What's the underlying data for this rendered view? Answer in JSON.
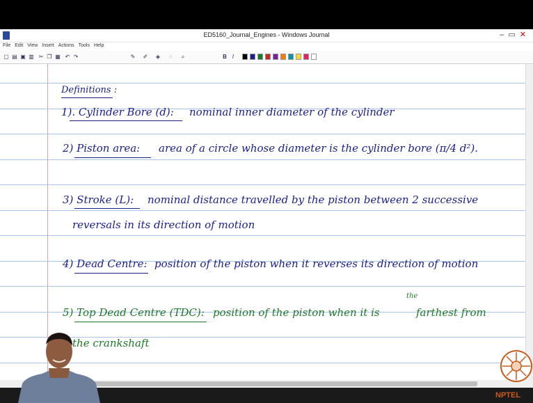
{
  "window": {
    "title": "ED5160_Journal_Engines - Windows Journal",
    "controls": [
      "–",
      "▭",
      "✕"
    ]
  },
  "menu": [
    "File",
    "Edit",
    "View",
    "Insert",
    "Actions",
    "Tools",
    "Help"
  ],
  "toolbar": {
    "icons": [
      "new-icon",
      "open-icon",
      "save-icon",
      "print-icon",
      "cut-icon",
      "copy-icon",
      "paste-icon",
      "undo-icon",
      "redo-icon",
      "pen-icon",
      "highlighter-icon",
      "eraser-icon",
      "lasso-icon",
      "zoom-icon"
    ],
    "format": [
      "B",
      "I"
    ],
    "colors": [
      "#000000",
      "#1b1f8a",
      "#1d7a28",
      "#c62828",
      "#7b1fa2",
      "#f57c00",
      "#0097a7",
      "#fdd835",
      "#e91e63",
      "#ffffff"
    ]
  },
  "journal": {
    "heading": "Definitions :",
    "items": [
      {
        "term": "1). Cylinder Bore (d):",
        "def": "nominal inner diameter of the cylinder"
      },
      {
        "term": "2) Piston area:",
        "def": "area of a circle whose diameter is the cylinder bore (π/4 d²)."
      },
      {
        "term": "3) Stroke (L):",
        "def": "nominal distance travelled by the piston between 2 successive",
        "def2": "reversals in its direction of motion"
      },
      {
        "term": "4) Dead Centre:",
        "def": "position of the piston when it reverses its direction of motion"
      },
      {
        "term": "5) Top Dead Centre (TDC):",
        "def": "position of the piston when it is",
        "insert": "the",
        "def_end": "farthest from",
        "def2": "the crankshaft"
      }
    ]
  },
  "branding": {
    "logo": "NPTEL"
  }
}
